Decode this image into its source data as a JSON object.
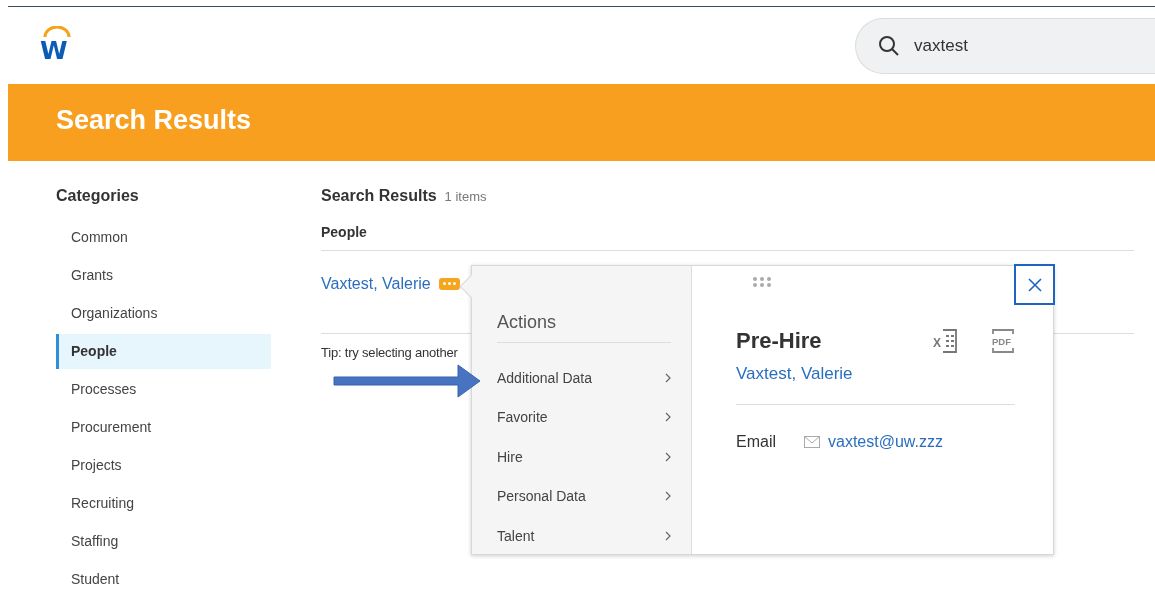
{
  "logo": {
    "letter": "W"
  },
  "search": {
    "value": "vaxtest"
  },
  "banner": {
    "title": "Search Results"
  },
  "sidebar": {
    "title": "Categories",
    "items": [
      {
        "label": "Common",
        "selected": false
      },
      {
        "label": "Grants",
        "selected": false
      },
      {
        "label": "Organizations",
        "selected": false
      },
      {
        "label": "People",
        "selected": true
      },
      {
        "label": "Processes",
        "selected": false
      },
      {
        "label": "Procurement",
        "selected": false
      },
      {
        "label": "Projects",
        "selected": false
      },
      {
        "label": "Recruiting",
        "selected": false
      },
      {
        "label": "Staffing",
        "selected": false
      },
      {
        "label": "Student",
        "selected": false
      }
    ]
  },
  "results": {
    "title": "Search Results",
    "count": "1 items",
    "group": "People",
    "result": "Vaxtest, Valerie",
    "tip": "Tip: try selecting another"
  },
  "popup": {
    "menu_title": "Actions",
    "menu_items": [
      "Additional Data",
      "Favorite",
      "Hire",
      "Personal Data",
      "Talent"
    ],
    "title": "Pre-Hire",
    "name": "Vaxtest, Valerie",
    "excel_label": "X",
    "pdf_label": "PDF",
    "fields": [
      {
        "label": "Email",
        "value": "vaxtest@uw.zzz"
      }
    ]
  }
}
